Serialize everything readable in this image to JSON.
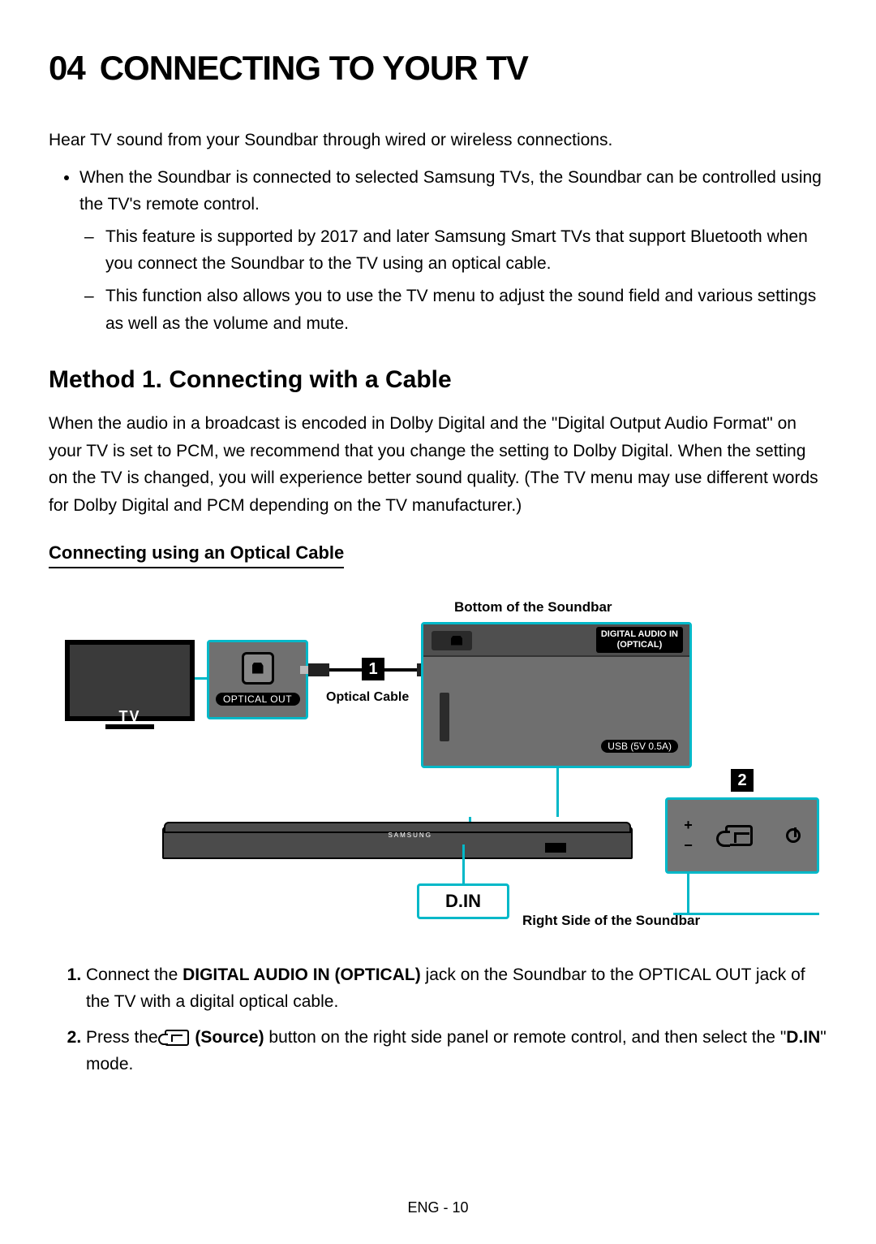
{
  "chapter": {
    "num": "04",
    "title": "CONNECTING TO YOUR TV"
  },
  "intro": "Hear TV sound from your Soundbar through wired or wireless connections.",
  "intro_bullet": "When the Soundbar is connected to selected Samsung TVs, the Soundbar can be controlled using the TV's remote control.",
  "intro_sub1": "This feature is supported by 2017 and later Samsung Smart TVs that support Bluetooth when you connect the Soundbar to the TV using an optical cable.",
  "intro_sub2": "This function also allows you to use the TV menu to adjust the sound field and various settings as well as the volume and mute.",
  "method_title": "Method 1. Connecting with a Cable",
  "method_body": "When the audio in a broadcast is encoded in Dolby Digital and the \"Digital Output Audio Format\" on your TV is set to PCM, we recommend that you change the setting to Dolby Digital. When the setting on the TV is changed, you will experience better sound quality. (The TV menu may use different words for Dolby Digital and PCM depending on the TV manufacturer.)",
  "sub_title": "Connecting using an Optical Cable",
  "diagram": {
    "bottom_label": "Bottom of the Soundbar",
    "right_label": "Right Side of the Soundbar",
    "tv_label": "TV",
    "optical_out": "OPTICAL OUT",
    "cable_label": "Optical Cable",
    "dai_line1": "DIGITAL AUDIO IN",
    "dai_line2": "(OPTICAL)",
    "usb_label": "USB (5V 0.5A)",
    "din": "D.IN",
    "tag1": "1",
    "tag2": "2",
    "vol_plus": "+",
    "vol_minus": "−"
  },
  "steps": {
    "s1_pre": "Connect the ",
    "s1_bold": "DIGITAL AUDIO IN (OPTICAL)",
    "s1_post": " jack on the Soundbar to the OPTICAL OUT jack of the TV with a digital optical cable.",
    "s2_pre": "Press the ",
    "s2_bold": "(Source)",
    "s2_mid": " button on the right side panel or remote control, and then select the \"",
    "s2_bold2": "D.IN",
    "s2_post": "\" mode."
  },
  "footer": "ENG - 10"
}
